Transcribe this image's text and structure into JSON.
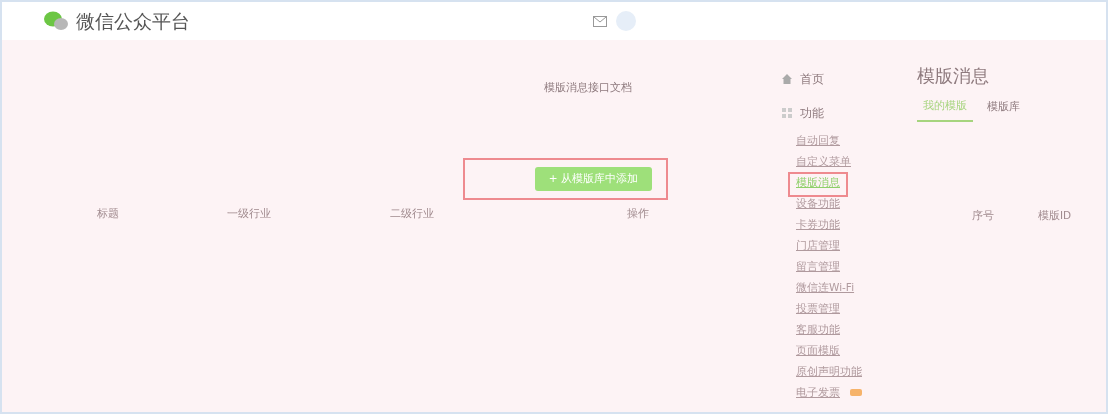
{
  "header": {
    "logo_text": "微信公众平台"
  },
  "doc_link": "模版消息接口文档",
  "add_button": {
    "icon": "+",
    "label": "从模版库中添加"
  },
  "table": {
    "columns": [
      "标题",
      "一级行业",
      "二级行业",
      "操作"
    ]
  },
  "sidebar": {
    "items": [
      {
        "kind": "section",
        "label": "首页",
        "selected": false
      },
      {
        "kind": "section",
        "label": "功能",
        "selected": false
      },
      {
        "kind": "item",
        "label": "自动回复",
        "selected": false
      },
      {
        "kind": "item",
        "label": "自定义菜单",
        "selected": false
      },
      {
        "kind": "item",
        "label": "模版消息",
        "selected": true
      },
      {
        "kind": "item",
        "label": "设备功能",
        "selected": false
      },
      {
        "kind": "item",
        "label": "卡券功能",
        "selected": false
      },
      {
        "kind": "item",
        "label": "门店管理",
        "selected": false
      },
      {
        "kind": "item",
        "label": "留言管理",
        "selected": false
      },
      {
        "kind": "item",
        "label": "微信连Wi-Fi",
        "selected": false
      },
      {
        "kind": "item",
        "label": "投票管理",
        "selected": false
      },
      {
        "kind": "item",
        "label": "客服功能",
        "selected": false
      },
      {
        "kind": "item",
        "label": "页面模版",
        "selected": false
      },
      {
        "kind": "item",
        "label": "原创声明功能",
        "selected": false
      },
      {
        "kind": "item",
        "label": "电子发票",
        "selected": false,
        "badge": true
      }
    ]
  },
  "content": {
    "title": "模版消息",
    "tabs": [
      {
        "label": "我的模版",
        "selected": true
      },
      {
        "label": "模版库",
        "selected": false
      }
    ],
    "columns": [
      "序号",
      "模版ID"
    ]
  }
}
